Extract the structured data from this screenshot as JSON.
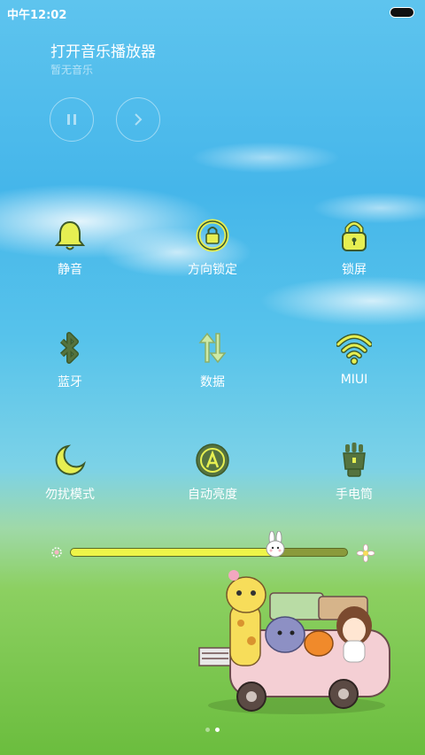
{
  "status_bar": {
    "time": "中午12:02"
  },
  "music": {
    "title": "打开音乐播放器",
    "subtitle": "暂无音乐",
    "pause_icon": "pause-icon",
    "next_icon": "next-icon"
  },
  "toggles": [
    {
      "label": "静音",
      "icon": "bell-icon"
    },
    {
      "label": "方向锁定",
      "icon": "rotation-lock-icon"
    },
    {
      "label": "锁屏",
      "icon": "padlock-icon"
    },
    {
      "label": "蓝牙",
      "icon": "bluetooth-icon"
    },
    {
      "label": "数据",
      "icon": "data-arrows-icon"
    },
    {
      "label": "MIUI",
      "icon": "wifi-icon"
    },
    {
      "label": "勿扰模式",
      "icon": "moon-icon"
    },
    {
      "label": "自动亮度",
      "icon": "auto-brightness-icon"
    },
    {
      "label": "手电筒",
      "icon": "flashlight-icon"
    }
  ],
  "brightness": {
    "level": 0.74
  },
  "page_indicator": {
    "count": 2,
    "active": 1
  },
  "colors": {
    "icon_fill": "#e6ef52",
    "icon_stroke": "#3d5a2b"
  }
}
